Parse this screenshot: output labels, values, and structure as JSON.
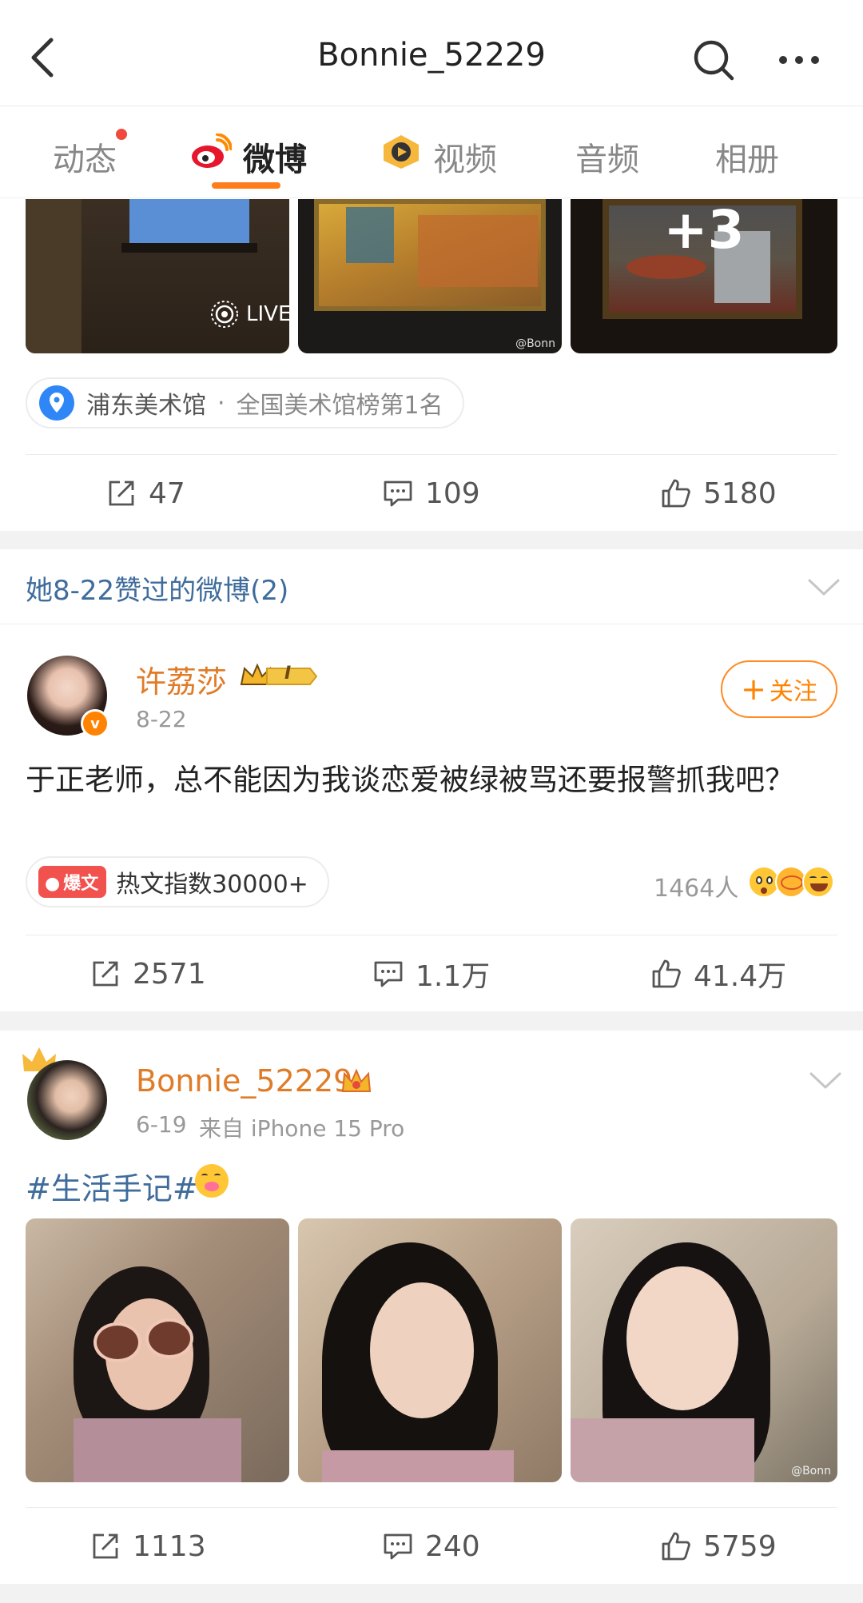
{
  "header": {
    "title": "Bonnie_52229"
  },
  "tabs": [
    {
      "label": "动态"
    },
    {
      "label": "微博"
    },
    {
      "label": "视频"
    },
    {
      "label": "音频"
    },
    {
      "label": "相册"
    }
  ],
  "post1": {
    "live_label": "LIVE",
    "more_count": "+3",
    "watermark": "@Bonn",
    "location": {
      "name": "浦东美术馆",
      "separator": "·",
      "rank": "全国美术馆榜第1名"
    },
    "actions": {
      "reposts": "47",
      "comments": "109",
      "likes": "5180"
    }
  },
  "liked_section": {
    "text": "她8-22赞过的微博(2)"
  },
  "post2": {
    "author": "许荔莎",
    "vip_level": "I",
    "verified_badge": "v",
    "date": "8-22",
    "follow_label": "关注",
    "follow_icon": "+",
    "text": "于正老师，总不能因为我谈恋爱被绿被骂还要报警抓我吧？",
    "hot_tag": "爆文",
    "hot_text": "热文指数30000+",
    "reaction_count": "1464人",
    "actions": {
      "reposts": "2571",
      "comments": "1.1万",
      "likes": "41.4万"
    }
  },
  "post3": {
    "author": "Bonnie_52229",
    "date": "6-19",
    "source": "来自 iPhone 15 Pro",
    "hashtag": "#生活手记#",
    "watermark": "@Bonn",
    "actions": {
      "reposts": "1113",
      "comments": "240",
      "likes": "5759"
    }
  },
  "colors": {
    "accent_orange": "#ff8200",
    "link_blue": "#3f6c9c",
    "name_orange": "#e07b27"
  }
}
